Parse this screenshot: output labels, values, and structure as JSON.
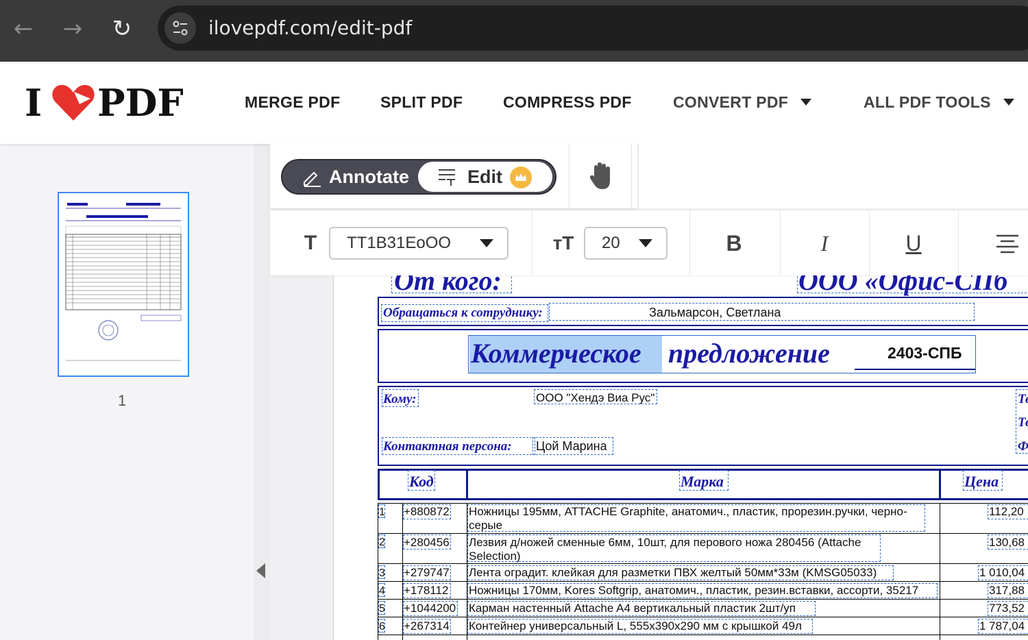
{
  "browser": {
    "url": "ilovepdf.com/edit-pdf",
    "back_icon": "←",
    "forward_icon": "→",
    "reload_icon": "↻"
  },
  "header": {
    "logo_left": "I",
    "logo_right": "PDF",
    "nav": [
      {
        "label": "MERGE PDF"
      },
      {
        "label": "SPLIT PDF"
      },
      {
        "label": "COMPRESS PDF"
      },
      {
        "label": "CONVERT PDF"
      },
      {
        "label": "ALL PDF TOOLS"
      }
    ]
  },
  "sidebar": {
    "page_number": "1"
  },
  "mode_bar": {
    "annotate_label": "Annotate",
    "edit_label": "Edit"
  },
  "format_bar": {
    "font_icon": "T",
    "font_name": "TT1B31EoOO",
    "size_icon": "тT",
    "font_size": "20",
    "bold": "B",
    "italic": "I",
    "underline": "U"
  },
  "document": {
    "from_label": "От кого:",
    "company": "ООО «Офис-СПб",
    "contact_label": "Обращаться к сотруднику:",
    "contact_name": "Зальмарсон, Светлана",
    "offer_word1": "Коммерческое",
    "offer_word2": "предложение",
    "offer_number": "2403-СПБ",
    "to_label": "Кому:",
    "to_value": "ООО \"Хендэ Виа Рус\"",
    "person_label": "Контактная персона:",
    "person_value": "Цой Марина",
    "side_labels": [
      "Те",
      "Те",
      "Ф"
    ],
    "col_code": "Код",
    "col_brand": "Марка",
    "col_price": "Цена",
    "rows": [
      {
        "n": "1",
        "code": "+880872",
        "name": "Ножницы 195мм, ATTACHE Graphite, анатомич., пластик, прорезин.ручки, черно-",
        "name2": "серые",
        "price": "112,20"
      },
      {
        "n": "2",
        "code": "+280456",
        "name": "Лезвия д/ножей сменные  6мм, 10шт, для перового ножа 280456 (Attache",
        "name2": "Selection)",
        "price": "130,68"
      },
      {
        "n": "3",
        "code": "+279747",
        "name": "Лента оградит. клейкая для разметки ПВХ желтый 50мм*33м (KMSG05033)",
        "name2": "",
        "price": "1 010,04"
      },
      {
        "n": "4",
        "code": "+178112",
        "name": "Ножницы 170мм, Kores Softgrip, анатомич., пластик, резин.вставки, ассорти, 35217",
        "name2": "",
        "price": "317,88"
      },
      {
        "n": "5",
        "code": "+1044200",
        "name": "Карман настенный Attache A4 вертикальный пластик 2шт/уп",
        "name2": "",
        "price": "773,52"
      },
      {
        "n": "6",
        "code": "+267314",
        "name": "Контейнер универсальный L, 555х390х290 мм с крышкой 49л",
        "name2": "",
        "price": "1 787,04"
      }
    ]
  }
}
